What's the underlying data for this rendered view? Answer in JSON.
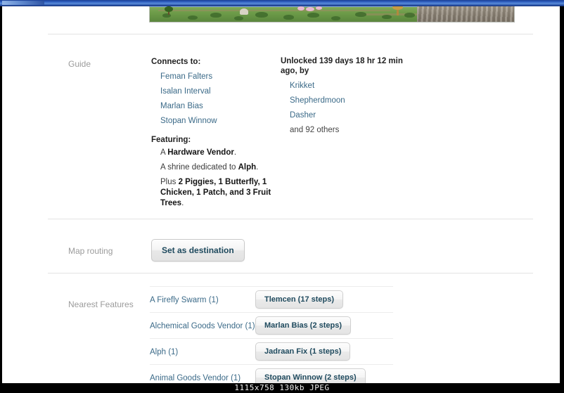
{
  "window": {
    "titlebar_present": true
  },
  "status_bar": {
    "text": "1115x758  130kb  JPEG"
  },
  "hero": {
    "alt": "game-location-screenshot-strip"
  },
  "sections": {
    "guide": {
      "label": "Guide",
      "connects": {
        "heading": "Connects to:",
        "items": [
          {
            "label": "Feman Falters"
          },
          {
            "label": "Isalan Interval"
          },
          {
            "label": "Marlan Bias"
          },
          {
            "label": "Stopan Winnow"
          }
        ]
      },
      "unlocked": {
        "heading": "Unlocked 139 days 18 hr 12 min ago, by",
        "items": [
          {
            "label": "Krikket"
          },
          {
            "label": "Shepherdmoon"
          },
          {
            "label": "Dasher"
          }
        ],
        "more": "and 92 others"
      },
      "featuring": {
        "heading": "Featuring:",
        "lines": [
          {
            "pre": "A ",
            "bold": "Hardware Vendor",
            "post": "."
          },
          {
            "pre": "A shrine dedicated to ",
            "bold": "Alph",
            "post": "."
          },
          {
            "pre": "Plus ",
            "bold": "2 Piggies, 1 Butterfly, 1 Chicken, 1 Patch, and 3 Fruit Trees",
            "post": "."
          }
        ]
      }
    },
    "map_routing": {
      "label": "Map routing",
      "set_destination_label": "Set as destination"
    },
    "nearest_features": {
      "label": "Nearest Features",
      "rows": [
        {
          "name": "A Firefly Swarm (1)",
          "route": "Tlemcen (17 steps)"
        },
        {
          "name": "Alchemical Goods Vendor (1)",
          "route": "Marlan Bias (2 steps)"
        },
        {
          "name": "Alph (1)",
          "route": "Jadraan Fix (1 steps)"
        },
        {
          "name": "Animal Goods Vendor (1)",
          "route": "Stopan Winnow (2 steps)"
        }
      ]
    }
  },
  "colors": {
    "link": "#3b6a88",
    "label_gray": "#9b9b9b",
    "button_text": "#1f4a5e",
    "rule": "#e3e3e3"
  }
}
